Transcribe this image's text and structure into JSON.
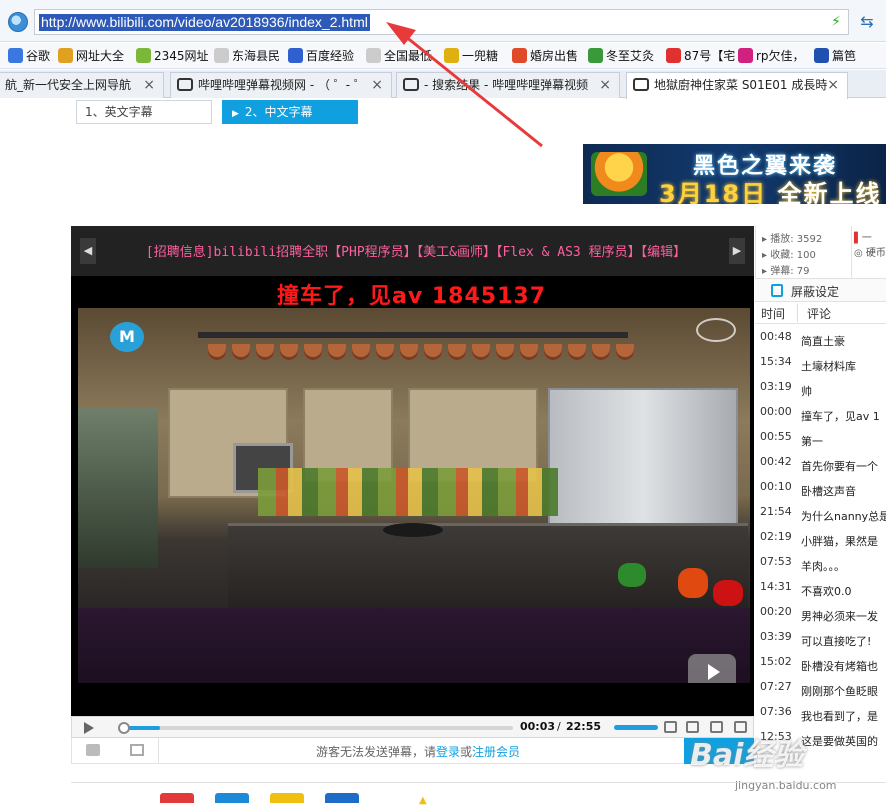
{
  "browser": {
    "url": "http://www.bilibili.com/video/av2018936/index_2.html",
    "bookmarks": [
      {
        "label": "谷歌",
        "color": "#3a77e0",
        "icon": "g-icon"
      },
      {
        "label": "网址大全",
        "color": "#e0a020",
        "icon": "globe-icon"
      },
      {
        "label": "2345网址",
        "color": "#7bb83a",
        "icon": "house-icon"
      },
      {
        "label": "东海县民",
        "color": "#cccccc",
        "icon": "page-icon"
      },
      {
        "label": "百度经验",
        "color": "#3060d0",
        "icon": "paw-icon"
      },
      {
        "label": "全国最低",
        "color": "#cccccc",
        "icon": "page-icon"
      },
      {
        "label": "一兜糖",
        "color": "#e0b010",
        "icon": "candy-icon"
      },
      {
        "label": "婚房出售",
        "color": "#e04a2a",
        "icon": "ring-icon"
      },
      {
        "label": "冬至艾灸",
        "color": "#3a9a3a",
        "icon": "grid-icon"
      },
      {
        "label": "87号【宅",
        "color": "#e03030",
        "icon": "fire-icon"
      },
      {
        "label": "rp欠佳，",
        "color": "#d02080",
        "icon": "mosaic-icon"
      },
      {
        "label": "篇笆",
        "color": "#2050b0",
        "icon": "user-icon"
      }
    ],
    "tabs": [
      {
        "label": "航_新一代安全上网导航",
        "active": false
      },
      {
        "label": "哔哩哔哩弹幕视频网 - （ ゜- ゜",
        "active": false
      },
      {
        "label": "- 搜索结果 - 哔哩哔哩弹幕视频",
        "active": false
      },
      {
        "label": "地獄廚神住家菜 S01E01 成長時",
        "active": true
      }
    ]
  },
  "page": {
    "subtitle_tabs": [
      {
        "label": "1、英文字幕",
        "active": false
      },
      {
        "label": "2、中文字幕",
        "active": true
      }
    ],
    "ad": {
      "line1": "黑色之翼来袭",
      "line2_date": "3月18日",
      "line2_rest": "全新上线"
    }
  },
  "player": {
    "recruit_text": "[招聘信息]bilibili招聘全职【PHP程序员】【美工&画师】【Flex & AS3 程序员】【编辑】",
    "danmaku": "撞车了，见av 1845137",
    "channel_logo": "M",
    "time_current": "00:03",
    "time_separator": "/",
    "time_total": "22:55",
    "progress_fraction": 0.02,
    "send_message_prefix": "游客无法发送弹幕，请",
    "login_link": "登录",
    "send_message_or": "或",
    "register_link": "注册会员"
  },
  "sidebar": {
    "stats": [
      {
        "label": "播放",
        "value": "3592"
      },
      {
        "label": "收藏",
        "value": "100"
      },
      {
        "label": "弹幕",
        "value": "79"
      }
    ],
    "stats_right": [
      "一",
      "硬币"
    ],
    "shield_label": "屏蔽设定",
    "header_time": "时间",
    "header_comment": "评论",
    "comments": [
      {
        "time": "00:48",
        "text": "简直土豪"
      },
      {
        "time": "15:34",
        "text": "土壕材料库"
      },
      {
        "time": "03:19",
        "text": "帅"
      },
      {
        "time": "00:00",
        "text": "撞车了，见av 1"
      },
      {
        "time": "00:55",
        "text": "第一"
      },
      {
        "time": "00:42",
        "text": "首先你要有一个"
      },
      {
        "time": "00:10",
        "text": "卧槽这声音"
      },
      {
        "time": "21:54",
        "text": "为什么nanny总是"
      },
      {
        "time": "02:19",
        "text": "小胖猫，果然是"
      },
      {
        "time": "07:53",
        "text": "羊肉。。。"
      },
      {
        "time": "14:31",
        "text": "不喜欢0.0"
      },
      {
        "time": "00:20",
        "text": "男神必须来一发"
      },
      {
        "time": "03:39",
        "text": "可以直接吃了!"
      },
      {
        "time": "15:02",
        "text": "卧槽没有烤箱也"
      },
      {
        "time": "07:27",
        "text": "刚刚那个鱼眨眼"
      },
      {
        "time": "07:36",
        "text": "我也看到了，是"
      },
      {
        "time": "12:53",
        "text": "这是要做英国的"
      }
    ]
  },
  "watermark": {
    "brand": "Bai经验",
    "url": "jingyan.baidu.com"
  },
  "colors": {
    "accent": "#10a0df",
    "danmaku": "#ff1a1a",
    "recruit": "#ff5fa0",
    "arrow": "#e83a3a"
  }
}
